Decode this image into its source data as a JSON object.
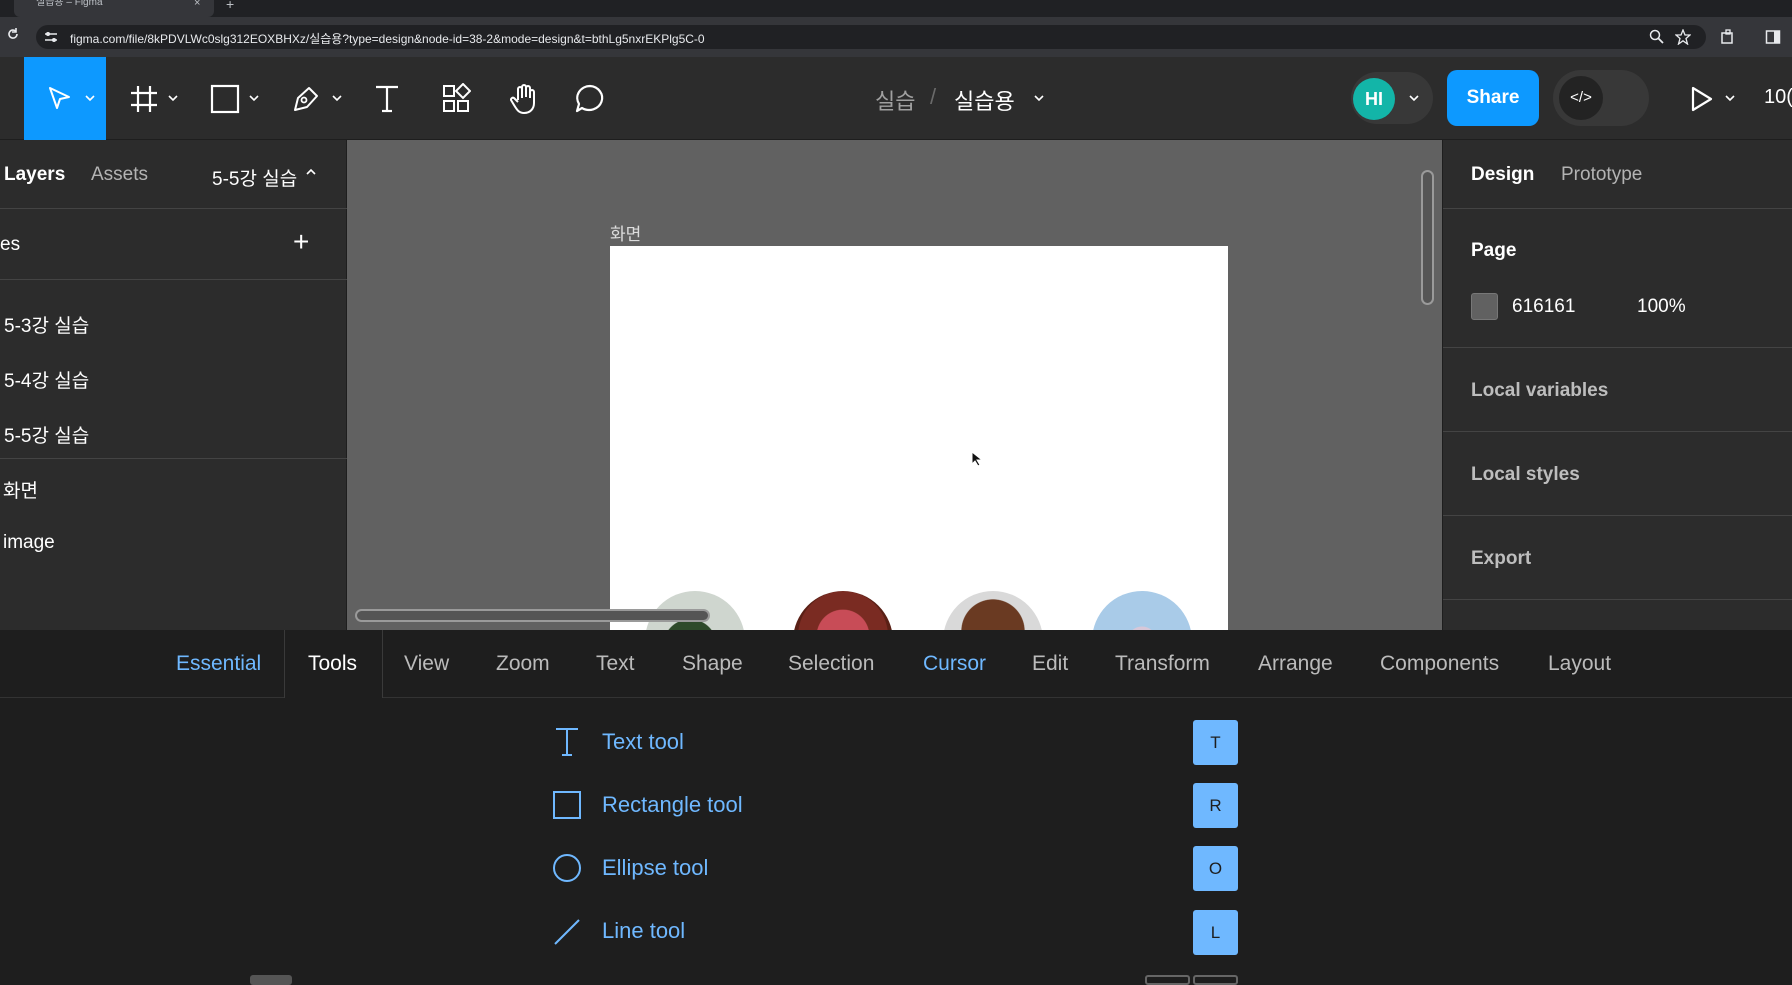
{
  "browser": {
    "tab_title": "실습용 – Figma",
    "tab_close": "×",
    "new_tab": "+",
    "url": "figma.com/file/8kPDVLWc0slg312EOXBHXz/실습용?type=design&node-id=38-2&mode=design&t=bthLg5nxrEKPlg5C-0"
  },
  "toolbar": {
    "breadcrumb_project": "실습",
    "breadcrumb_separator": "/",
    "breadcrumb_file": "실습용",
    "avatar_initials": "HI",
    "avatar_color": "#13b5a8",
    "share_label": "Share",
    "devmode_label": "</>",
    "zoom_partial": "10(",
    "accent": "#0d99ff"
  },
  "left_panel": {
    "tabs": [
      "Layers",
      "Assets"
    ],
    "current_page": "5-5강 실습",
    "pages_header": "es",
    "add_page": "+",
    "pages": [
      "5-3강 실습",
      "5-4강 실습",
      "5-5강 실습"
    ],
    "layers": [
      "화면",
      "image"
    ]
  },
  "canvas": {
    "background": "#616161",
    "frame_label": "화면"
  },
  "right_panel": {
    "tabs": [
      "Design",
      "Prototype"
    ],
    "page_section": "Page",
    "page_color_hex": "616161",
    "page_color_opacity": "100%",
    "sections": [
      "Local variables",
      "Local styles",
      "Export"
    ]
  },
  "shortcuts": {
    "tabs": [
      "Essential",
      "Tools",
      "View",
      "Zoom",
      "Text",
      "Shape",
      "Selection",
      "Cursor",
      "Edit",
      "Transform",
      "Arrange",
      "Components",
      "Layout"
    ],
    "selected_tab": "Tools",
    "rows": [
      {
        "label": "Text tool",
        "key": "T",
        "icon": "text-tool-icon"
      },
      {
        "label": "Rectangle tool",
        "key": "R",
        "icon": "rectangle-tool-icon"
      },
      {
        "label": "Ellipse tool",
        "key": "O",
        "icon": "ellipse-tool-icon"
      },
      {
        "label": "Line tool",
        "key": "L",
        "icon": "line-tool-icon"
      }
    ],
    "highlight_color": "#6fb8ff"
  }
}
